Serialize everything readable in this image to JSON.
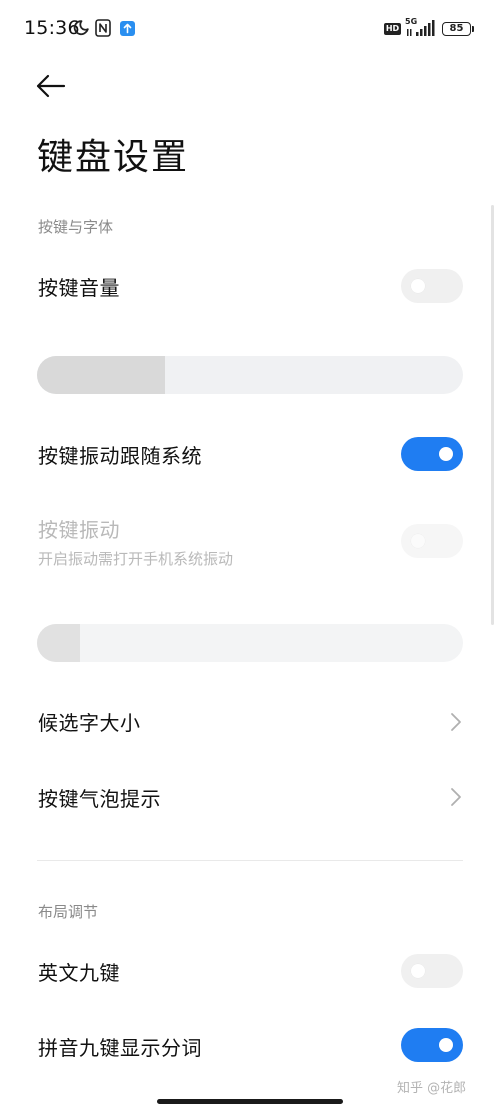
{
  "status_bar": {
    "time": "15:36",
    "network": "5G",
    "hd": "HD",
    "battery": "85"
  },
  "header": {
    "title": "键盘设置"
  },
  "sections": {
    "keys_and_font": {
      "header": "按键与字体",
      "key_volume": {
        "label": "按键音量",
        "enabled": false,
        "slider_level": 0.3
      },
      "vibration_follow_system": {
        "label": "按键振动跟随系统",
        "enabled": true
      },
      "key_vibration": {
        "label": "按键振动",
        "subtitle": "开启振动需打开手机系统振动",
        "enabled": false,
        "disabled": true,
        "slider_level": 0.1
      },
      "candidate_font_size": {
        "label": "候选字大小"
      },
      "key_bubble_hint": {
        "label": "按键气泡提示"
      }
    },
    "layout": {
      "header": "布局调节",
      "english_nine_key": {
        "label": "英文九键",
        "enabled": false
      },
      "pinyin_nine_key_split": {
        "label": "拼音九键显示分词",
        "enabled": true
      }
    }
  },
  "watermark": "知乎 @花郎",
  "colors": {
    "accent": "#1f7df2",
    "toggle_off": "#f0f0f0",
    "text_primary": "#111111",
    "text_secondary": "#8a8a8a",
    "text_disabled": "#b9b9b9"
  }
}
